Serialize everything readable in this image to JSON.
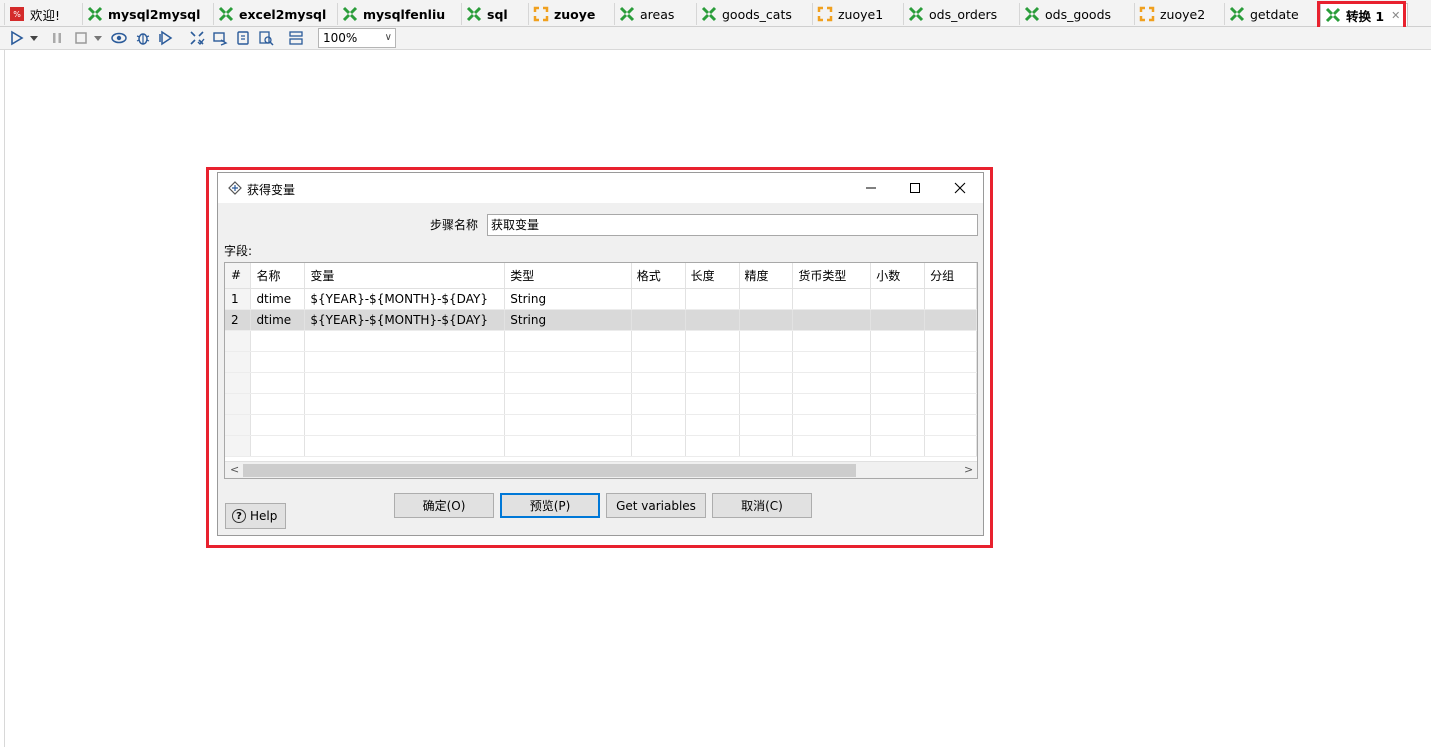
{
  "tabs": [
    {
      "label": "欢迎!",
      "icon": "welcome-icon",
      "bold": false
    },
    {
      "label": "mysql2mysql",
      "icon": "transformation-icon",
      "bold": true
    },
    {
      "label": "excel2mysql",
      "icon": "transformation-icon",
      "bold": true
    },
    {
      "label": "mysqlfenliu",
      "icon": "transformation-icon",
      "bold": true
    },
    {
      "label": "sql",
      "icon": "transformation-icon",
      "bold": true
    },
    {
      "label": "zuoye",
      "icon": "job-icon",
      "bold": true
    },
    {
      "label": "areas",
      "icon": "transformation-icon",
      "bold": false
    },
    {
      "label": "goods_cats",
      "icon": "transformation-icon",
      "bold": false
    },
    {
      "label": "zuoye1",
      "icon": "job-icon",
      "bold": false
    },
    {
      "label": "ods_orders",
      "icon": "transformation-icon",
      "bold": false
    },
    {
      "label": "ods_goods",
      "icon": "transformation-icon",
      "bold": false
    },
    {
      "label": "zuoye2",
      "icon": "job-icon",
      "bold": false
    },
    {
      "label": "getdate",
      "icon": "transformation-icon",
      "bold": false
    },
    {
      "label": "转换 1",
      "icon": "transformation-icon",
      "bold": true,
      "active": true
    }
  ],
  "toolbar": {
    "zoom": "100%",
    "icons": [
      "run-icon",
      "dropdown-icon",
      "pause-icon",
      "stop-icon",
      "dropdown-icon",
      "preview-icon",
      "debug-icon",
      "replay-icon",
      "verify-icon",
      "impact-icon",
      "sql-icon",
      "explore-db-icon",
      "show-results-icon"
    ]
  },
  "dialog": {
    "title": "获得变量",
    "step_name_label": "步骤名称",
    "step_name_value": "获取变量",
    "fields_label": "字段:",
    "columns": [
      "#",
      "名称",
      "变量",
      "类型",
      "格式",
      "长度",
      "精度",
      "货币类型",
      "小数",
      "分组"
    ],
    "rows": [
      [
        "1",
        "dtime",
        "${YEAR}-${MONTH}-${DAY}",
        "String",
        "",
        "",
        "",
        "",
        "",
        ""
      ],
      [
        "2",
        "dtime",
        "${YEAR}-${MONTH}-${DAY}",
        "String",
        "",
        "",
        "",
        "",
        "",
        ""
      ]
    ],
    "selected_row": 2,
    "buttons": {
      "ok": "确定(O)",
      "preview": "预览(P)",
      "get_vars": "Get variables",
      "cancel": "取消(C)"
    },
    "help": "Help"
  },
  "colors": {
    "highlight": "#e8212e",
    "transformation_icon": "#2a9d3a",
    "job_icon": "#f0a01e"
  }
}
